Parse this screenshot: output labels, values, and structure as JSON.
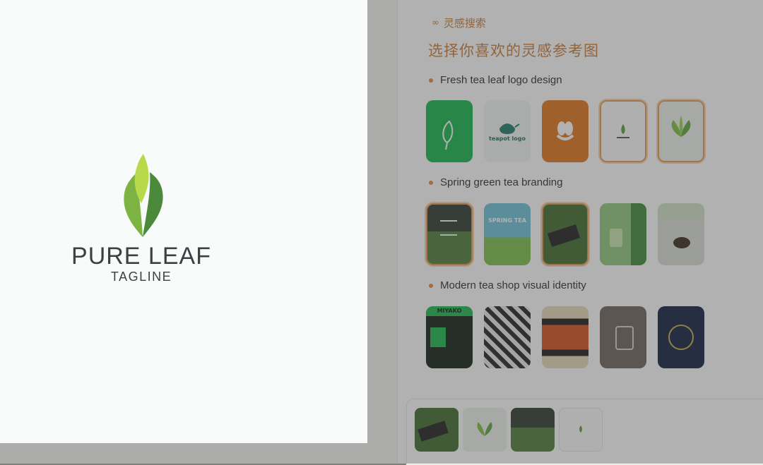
{
  "panel": {
    "search_tag": "灵感搜索",
    "title": "选择你喜欢的灵感参考图",
    "groups": [
      {
        "label": "Fresh tea leaf logo design"
      },
      {
        "label": "Spring green tea branding"
      },
      {
        "label": "Modern tea shop visual identity"
      }
    ],
    "thumb_texts": {
      "teapot_logo": "teapot logo",
      "spring_tea": "SPRING TEA",
      "miyako": "MIYAKO"
    }
  },
  "preview": {
    "brand_name": "PURE LEAF",
    "tagline": "TAGLINE"
  },
  "colors": {
    "accent": "#c97a34",
    "leaf_light": "#b8d94a",
    "leaf_mid": "#7cb342",
    "leaf_dark": "#4a8a3a",
    "brand_text": "#3e3f42"
  }
}
